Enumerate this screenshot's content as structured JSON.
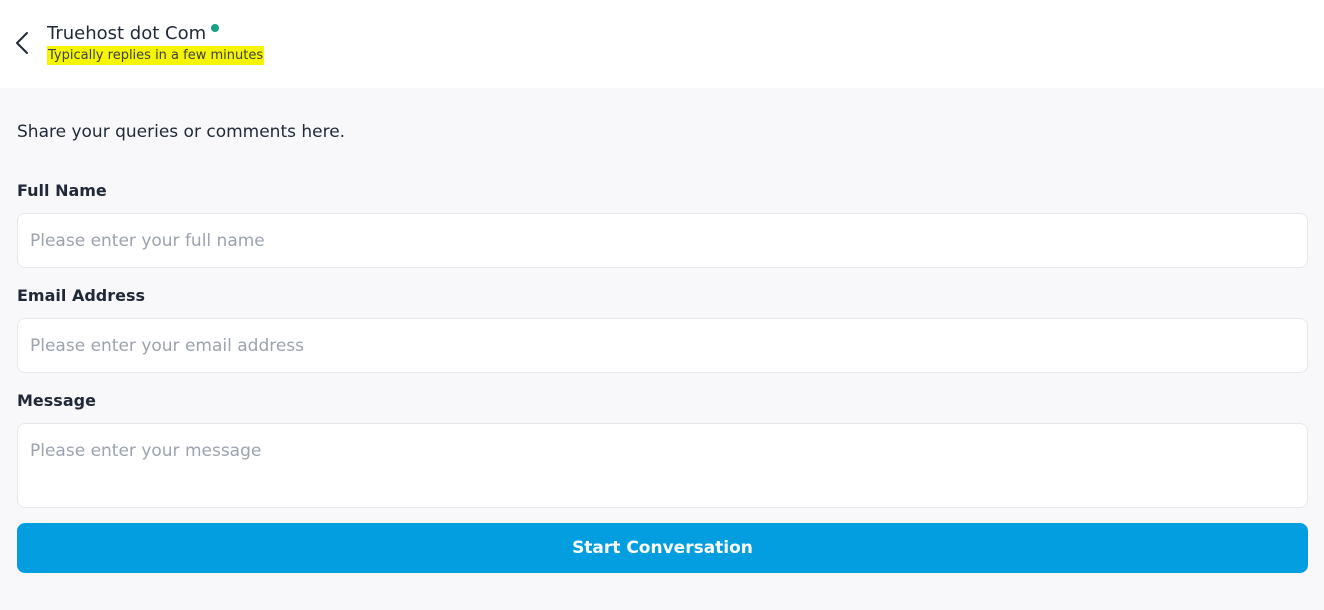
{
  "header": {
    "back_icon": "chevron-left-icon",
    "agent_name": "Truehost dot Com",
    "status_text": "Typically replies in a few minutes",
    "online_color": "#14a085",
    "highlight_color": "#f5f500"
  },
  "form": {
    "intro": "Share your queries or comments here.",
    "full_name": {
      "label": "Full Name",
      "placeholder": "Please enter your full name",
      "value": ""
    },
    "email": {
      "label": "Email Address",
      "placeholder": "Please enter your email address",
      "value": ""
    },
    "message": {
      "label": "Message",
      "placeholder": "Please enter your message",
      "value": ""
    },
    "submit_label": "Start Conversation",
    "accent_color": "#039ee0"
  }
}
